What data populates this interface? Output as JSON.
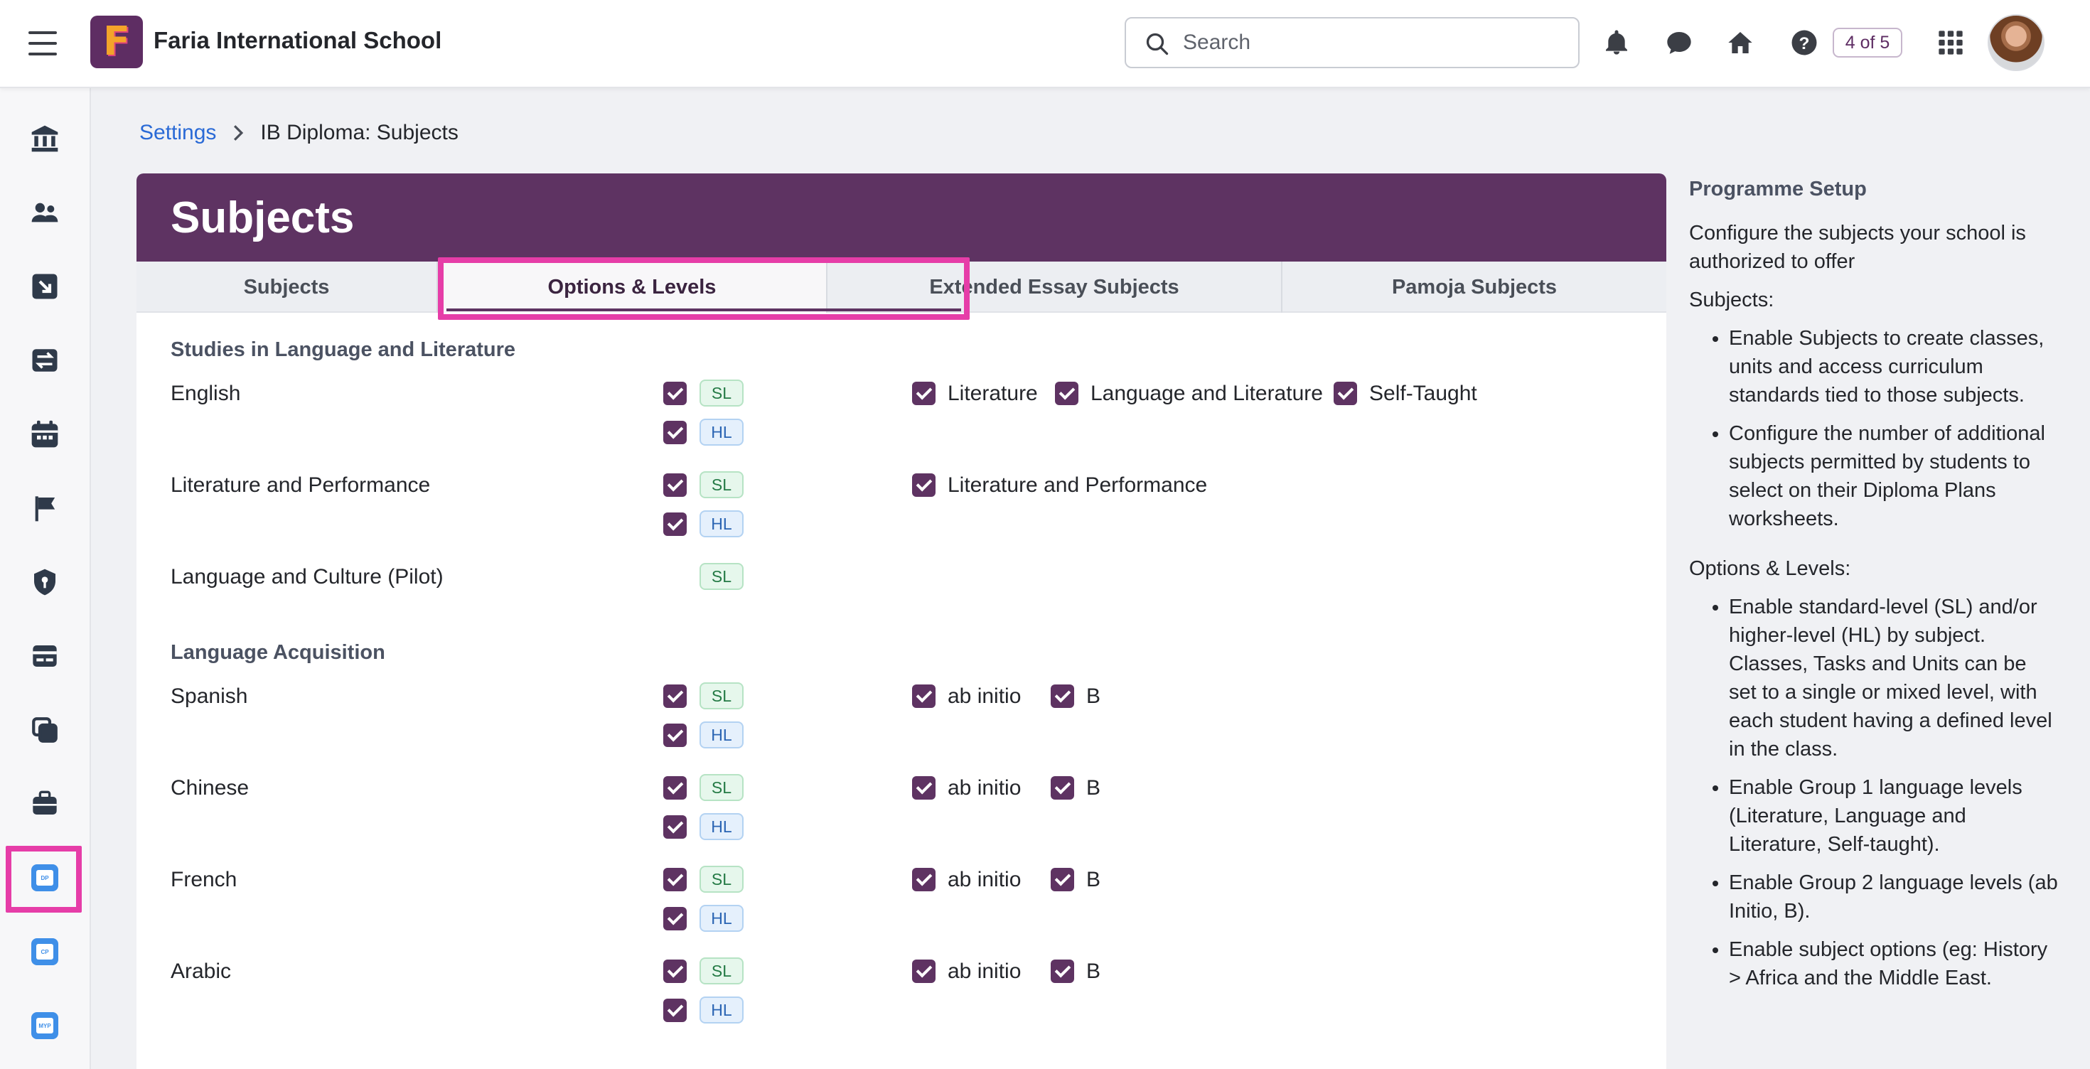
{
  "app": {
    "school_name": "Faria International School",
    "logo_letter": "F"
  },
  "search": {
    "placeholder": "Search",
    "value": ""
  },
  "header_badge": "4 of 5",
  "sidebar": {
    "items": [
      {
        "name": "institution-icon"
      },
      {
        "name": "people-icon"
      },
      {
        "name": "import-icon"
      },
      {
        "name": "transfer-icon"
      },
      {
        "name": "calendar-icon"
      },
      {
        "name": "flag-icon"
      },
      {
        "name": "shield-icon"
      },
      {
        "name": "card-icon"
      },
      {
        "name": "copy-icon"
      },
      {
        "name": "briefcase-icon"
      },
      {
        "name": "dp-programme-icon",
        "label": "DP",
        "active": true
      },
      {
        "name": "cp-programme-icon",
        "label": "CP"
      },
      {
        "name": "myp-programme-icon",
        "label": "MYP"
      }
    ]
  },
  "breadcrumb": {
    "root": "Settings",
    "current": "IB Diploma: Subjects"
  },
  "page": {
    "title": "Subjects",
    "tabs": [
      {
        "label": "Subjects",
        "active": false
      },
      {
        "label": "Options & Levels",
        "active": true
      },
      {
        "label": "Extended Essay Subjects",
        "active": false
      },
      {
        "label": "Pamoja Subjects",
        "active": false
      }
    ]
  },
  "sections": [
    {
      "title": "Studies in Language and Literature",
      "subjects": [
        {
          "name": "English",
          "sl": true,
          "hl": true,
          "options": [
            "Literature",
            "Language and Literature",
            "Self-Taught"
          ]
        },
        {
          "name": "Literature and Performance",
          "sl": true,
          "hl": true,
          "options": [
            "Literature and Performance"
          ]
        },
        {
          "name": "Language and Culture (Pilot)",
          "sl_only_badge": true,
          "options": []
        }
      ]
    },
    {
      "title": "Language Acquisition",
      "subjects": [
        {
          "name": "Spanish",
          "sl": true,
          "hl": true,
          "options": [
            "ab initio",
            "B"
          ]
        },
        {
          "name": "Chinese",
          "sl": true,
          "hl": true,
          "options": [
            "ab initio",
            "B"
          ]
        },
        {
          "name": "French",
          "sl": true,
          "hl": true,
          "options": [
            "ab initio",
            "B"
          ]
        },
        {
          "name": "Arabic",
          "sl": true,
          "hl": true,
          "options": [
            "ab initio",
            "B"
          ]
        }
      ]
    }
  ],
  "level_labels": {
    "sl": "SL",
    "hl": "HL"
  },
  "help": {
    "title": "Programme Setup",
    "intro": "Configure the subjects your school is authorized to offer",
    "subjects_heading": "Subjects:",
    "subjects_points": [
      "Enable Subjects to create classes, units and access curriculum standards tied to those subjects.",
      "Configure the number of additional subjects permitted by students to select on their Diploma Plans worksheets."
    ],
    "options_heading": "Options & Levels:",
    "options_points": [
      "Enable standard-level (SL) and/or higher-level (HL) by subject. Classes, Tasks and Units can be set to a single or mixed level, with each student having a defined level in the class.",
      "Enable Group 1 language levels (Literature, Language and Literature, Self-taught).",
      "Enable Group 2 language levels (ab Initio, B).",
      "Enable subject options (eg: History > Africa and the Middle East."
    ]
  },
  "colors": {
    "brand_purple": "#5e3362",
    "highlight_pink": "#e63da8",
    "link_blue": "#2a6ad6"
  }
}
